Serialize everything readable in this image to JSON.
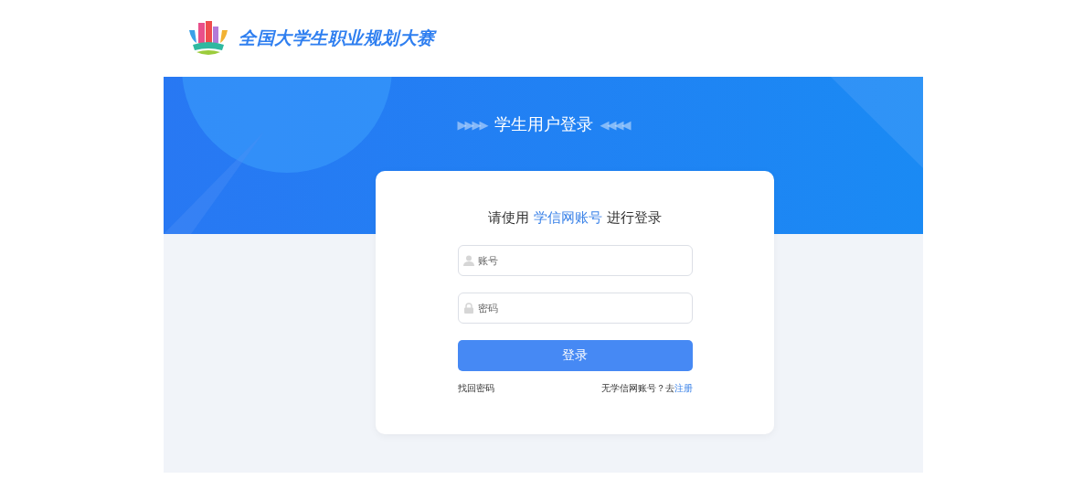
{
  "header": {
    "site_title": "全国大学生职业规划大赛"
  },
  "banner": {
    "title": "学生用户登录",
    "left_arrows": "▶▶▶▶",
    "right_arrows": "◀◀◀◀"
  },
  "login": {
    "heading": {
      "before": "请使用 ",
      "highlight": "学信网账号",
      "after": " 进行登录"
    },
    "fields": [
      {
        "kind": "user",
        "placeholder": "账号"
      },
      {
        "kind": "password",
        "placeholder": "密码"
      }
    ],
    "submit": "登录",
    "forgot": "找回密码",
    "register_prompt": "无学信网账号？去",
    "register_link": "注册"
  }
}
